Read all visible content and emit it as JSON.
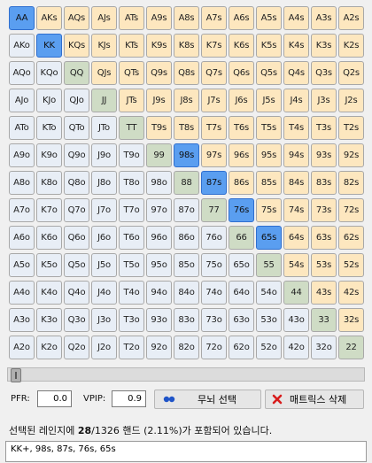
{
  "hands": [
    [
      "AA",
      "AKs",
      "AQs",
      "AJs",
      "ATs",
      "A9s",
      "A8s",
      "A7s",
      "A6s",
      "A5s",
      "A4s",
      "A3s",
      "A2s"
    ],
    [
      "AKo",
      "KK",
      "KQs",
      "KJs",
      "KTs",
      "K9s",
      "K8s",
      "K7s",
      "K6s",
      "K5s",
      "K4s",
      "K3s",
      "K2s"
    ],
    [
      "AQo",
      "KQo",
      "QQ",
      "QJs",
      "QTs",
      "Q9s",
      "Q8s",
      "Q7s",
      "Q6s",
      "Q5s",
      "Q4s",
      "Q3s",
      "Q2s"
    ],
    [
      "AJo",
      "KJo",
      "QJo",
      "JJ",
      "JTs",
      "J9s",
      "J8s",
      "J7s",
      "J6s",
      "J5s",
      "J4s",
      "J3s",
      "J2s"
    ],
    [
      "ATo",
      "KTo",
      "QTo",
      "JTo",
      "TT",
      "T9s",
      "T8s",
      "T7s",
      "T6s",
      "T5s",
      "T4s",
      "T3s",
      "T2s"
    ],
    [
      "A9o",
      "K9o",
      "Q9o",
      "J9o",
      "T9o",
      "99",
      "98s",
      "97s",
      "96s",
      "95s",
      "94s",
      "93s",
      "92s"
    ],
    [
      "A8o",
      "K8o",
      "Q8o",
      "J8o",
      "T8o",
      "98o",
      "88",
      "87s",
      "86s",
      "85s",
      "84s",
      "83s",
      "82s"
    ],
    [
      "A7o",
      "K7o",
      "Q7o",
      "J7o",
      "T7o",
      "97o",
      "87o",
      "77",
      "76s",
      "75s",
      "74s",
      "73s",
      "72s"
    ],
    [
      "A6o",
      "K6o",
      "Q6o",
      "J6o",
      "T6o",
      "96o",
      "86o",
      "76o",
      "66",
      "65s",
      "64s",
      "63s",
      "62s"
    ],
    [
      "A5o",
      "K5o",
      "Q5o",
      "J5o",
      "T5o",
      "95o",
      "85o",
      "75o",
      "65o",
      "55",
      "54s",
      "53s",
      "52s"
    ],
    [
      "A4o",
      "K4o",
      "Q4o",
      "J4o",
      "T4o",
      "94o",
      "84o",
      "74o",
      "64o",
      "54o",
      "44",
      "43s",
      "42s"
    ],
    [
      "A3o",
      "K3o",
      "Q3o",
      "J3o",
      "T3o",
      "93o",
      "83o",
      "73o",
      "63o",
      "53o",
      "43o",
      "33",
      "32s"
    ],
    [
      "A2o",
      "K2o",
      "Q2o",
      "J2o",
      "T2o",
      "92o",
      "82o",
      "72o",
      "62o",
      "52o",
      "42o",
      "32o",
      "22"
    ]
  ],
  "selected": [
    "AA",
    "KK",
    "98s",
    "87s",
    "76s",
    "65s"
  ],
  "colors": {
    "suited": "#fde7bf",
    "offsuit": "#e8eef6",
    "pair": "#cfdcc5",
    "selected": "#5a9ef0"
  },
  "slider": {
    "value_fraction": 0.0
  },
  "controls": {
    "pfr_label": "PFR:",
    "pfr_value": "0.0",
    "vpip_label": "VPIP:",
    "vpip_value": "0.9",
    "brain_button_label": "무뇌 선택",
    "brain_icon": "dots-icon",
    "delete_button_label": "매트릭스 삭제",
    "delete_icon": "red-x-icon"
  },
  "status": {
    "prefix": "선택된 레인지에 ",
    "count": "28",
    "total": "/1326",
    "suffix": " 핸드 (2.11%)가 포함되어 있습니다."
  },
  "range_text": "KK+, 98s, 87s, 76s, 65s"
}
